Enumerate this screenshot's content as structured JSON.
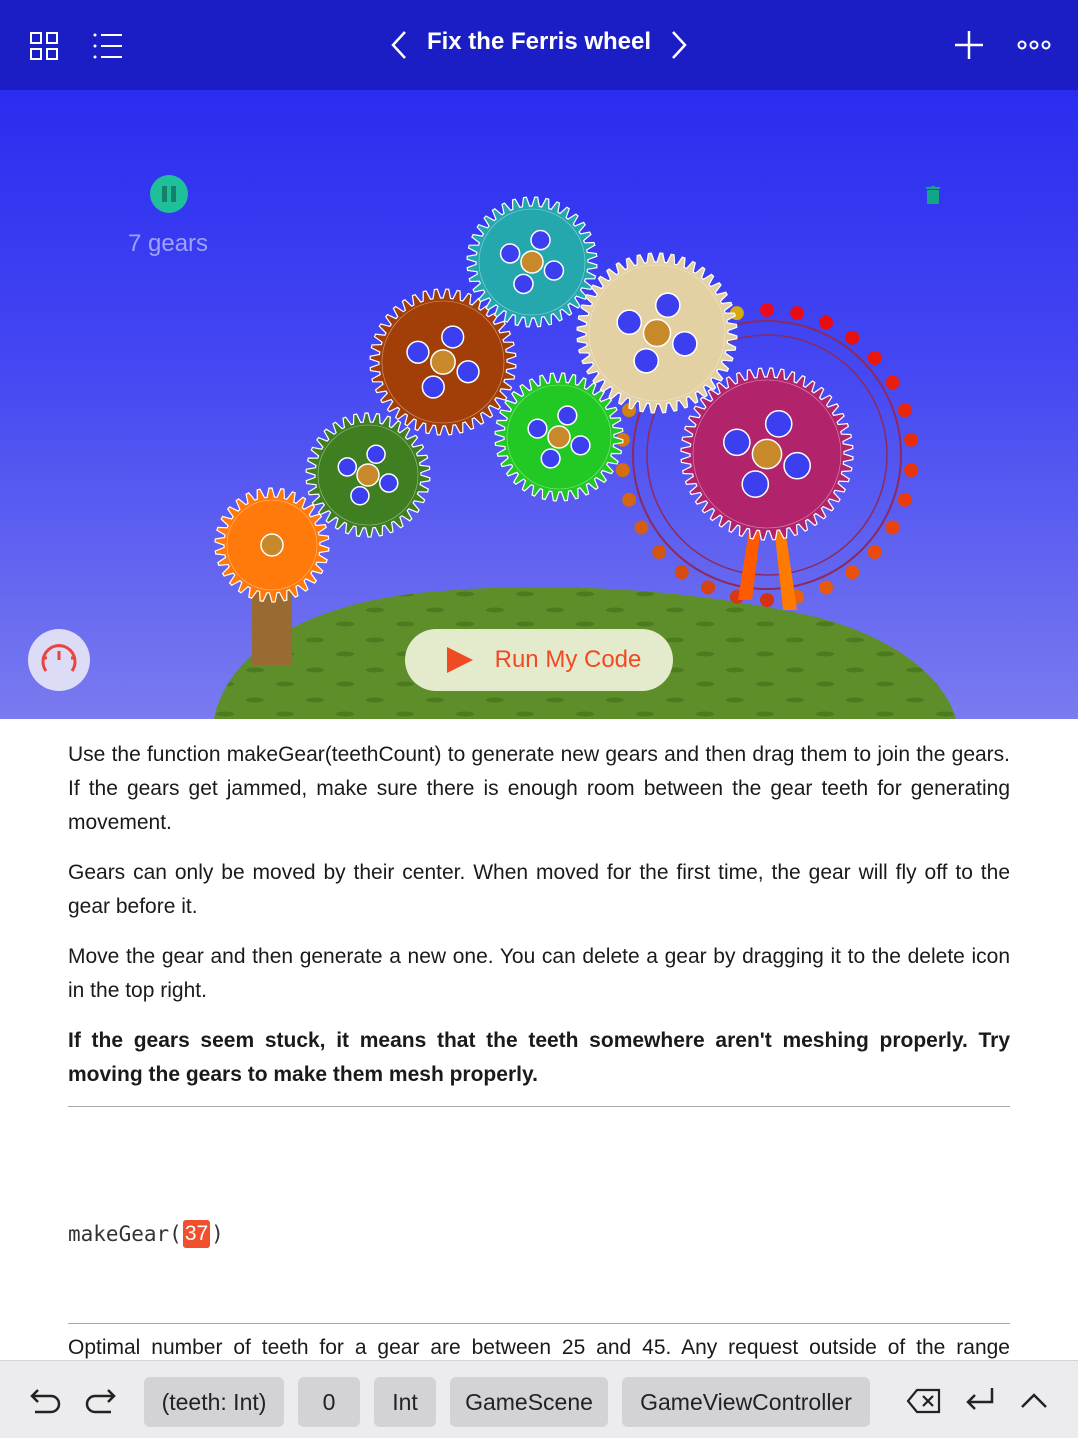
{
  "navbar": {
    "title": "Fix the Ferris wheel",
    "icons": [
      "grid-icon",
      "list-icon",
      "chevron-left-icon",
      "chevron-right-icon",
      "plus-icon",
      "more-icon"
    ]
  },
  "scene": {
    "gear_count_text": "7 gears",
    "run_button_label": "Run My Code",
    "colors": {
      "sky_top": "#2a2cf0",
      "sky_bottom": "#7a7bef",
      "hill": "#5a8a2a",
      "run_text": "#f04a24"
    }
  },
  "content": {
    "paragraphs": [
      "Use the function makeGear(teethCount) to generate new gears and then drag them to join the gears. If the gears get jammed, make sure there is enough room between the gear teeth for generating movement.",
      "Gears can only be moved by their center. When moved for the first time, the gear will fly off to the gear before it.",
      "Move the gear and then generate a new one. You can delete a gear by dragging it to the delete icon in the top right."
    ],
    "bold_paragraph": "If the gears seem stuck, it means that the teeth somewhere aren't meshing properly. Try moving the gears to make them mesh properly.",
    "code": {
      "function": "makeGear",
      "open_paren": "(",
      "argument": "37",
      "close_paren": ")"
    },
    "truncated_text": "Optimal number of teeth for a gear are between 25 and 45. Any request outside of the range"
  },
  "bottombar": {
    "chips": [
      "(teeth: Int)",
      "0",
      "Int",
      "GameScene",
      "GameViewController"
    ],
    "icons": [
      "undo-icon",
      "redo-icon",
      "delete-backward-icon",
      "return-icon",
      "chevron-up-icon"
    ]
  }
}
